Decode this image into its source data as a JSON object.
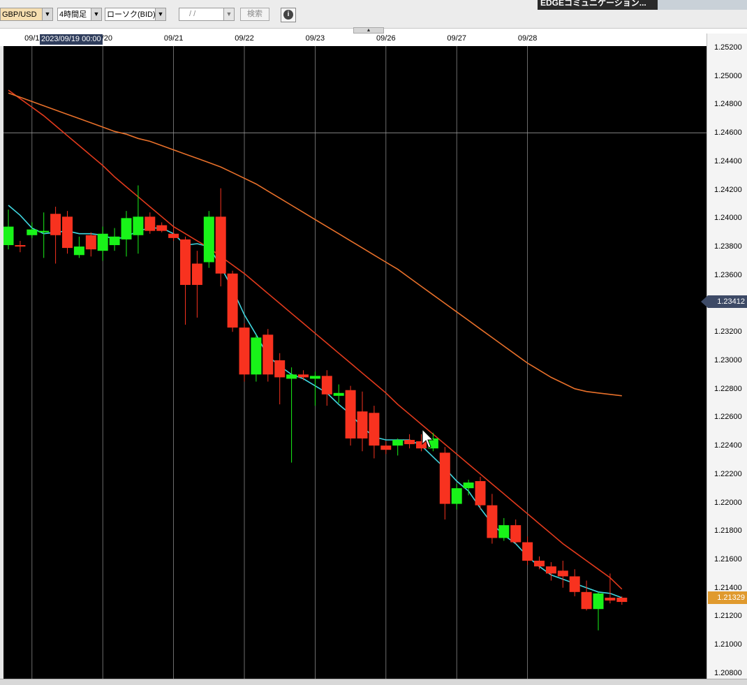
{
  "toolbar": {
    "pair": "GBP/USD",
    "timeframe": "4時間足",
    "chart_type": "ローソク(BID)",
    "date_placeholder": "/ /",
    "search_label": "検索",
    "info_label": "i",
    "webcam_label": "EDGEコミュニケーション..."
  },
  "crosshair": {
    "date_label": "2023/09/19 00:00",
    "price_label": "1.23412",
    "price_value": 1.23412
  },
  "current_price": {
    "label": "1.21329",
    "value": 1.21329
  },
  "colors": {
    "bull": "#19f319",
    "bear": "#f8321f",
    "ma_short": "#40d6e0",
    "ma_mid": "#e23a1c",
    "ma_long": "#e8702a",
    "grid": "#b4b4b4",
    "crosshair_tag": "#3d4a66",
    "current_tag": "#e09a2e"
  },
  "chart_data": {
    "type": "candlestick",
    "symbol": "GBP/USD",
    "timeframe": "4時間足",
    "ylim": [
      1.2076,
      1.2521
    ],
    "y_ticks": [
      "1.25200",
      "1.25000",
      "1.24800",
      "1.24600",
      "1.24400",
      "1.24200",
      "1.24000",
      "1.23800",
      "1.23600",
      "1.23400",
      "1.23200",
      "1.23000",
      "1.22800",
      "1.22600",
      "1.22400",
      "1.22200",
      "1.22000",
      "1.21800",
      "1.21600",
      "1.21400",
      "1.21200",
      "1.21000",
      "1.20800"
    ],
    "x_ticks": [
      {
        "label": "09/1",
        "index": 2
      },
      {
        "label": "09/20",
        "index": 8
      },
      {
        "label": "09/21",
        "index": 14
      },
      {
        "label": "09/22",
        "index": 20
      },
      {
        "label": "09/23",
        "index": 26
      },
      {
        "label": "09/26",
        "index": 32
      },
      {
        "label": "09/27",
        "index": 38
      },
      {
        "label": "09/28",
        "index": 44
      }
    ],
    "candles": [
      {
        "o": 1.2381,
        "h": 1.2406,
        "l": 1.2378,
        "c": 1.2394
      },
      {
        "o": 1.2381,
        "h": 1.2384,
        "l": 1.2376,
        "c": 1.238
      },
      {
        "o": 1.2388,
        "h": 1.2397,
        "l": 1.2386,
        "c": 1.2392
      },
      {
        "o": 1.239,
        "h": 1.2404,
        "l": 1.2372,
        "c": 1.2391
      },
      {
        "o": 1.2403,
        "h": 1.2408,
        "l": 1.2368,
        "c": 1.2388
      },
      {
        "o": 1.2401,
        "h": 1.2405,
        "l": 1.2375,
        "c": 1.2379
      },
      {
        "o": 1.2374,
        "h": 1.2387,
        "l": 1.2372,
        "c": 1.238
      },
      {
        "o": 1.2388,
        "h": 1.239,
        "l": 1.2373,
        "c": 1.2378
      },
      {
        "o": 1.2377,
        "h": 1.2394,
        "l": 1.237,
        "c": 1.2389
      },
      {
        "o": 1.2381,
        "h": 1.2393,
        "l": 1.2377,
        "c": 1.2387
      },
      {
        "o": 1.2385,
        "h": 1.2405,
        "l": 1.2373,
        "c": 1.24
      },
      {
        "o": 1.2388,
        "h": 1.2423,
        "l": 1.2375,
        "c": 1.2401
      },
      {
        "o": 1.2401,
        "h": 1.2404,
        "l": 1.2389,
        "c": 1.2391
      },
      {
        "o": 1.2395,
        "h": 1.2397,
        "l": 1.239,
        "c": 1.2391
      },
      {
        "o": 1.2389,
        "h": 1.2394,
        "l": 1.2384,
        "c": 1.2386
      },
      {
        "o": 1.2385,
        "h": 1.2387,
        "l": 1.2325,
        "c": 1.2353
      },
      {
        "o": 1.2368,
        "h": 1.2377,
        "l": 1.233,
        "c": 1.2353
      },
      {
        "o": 1.2369,
        "h": 1.2405,
        "l": 1.2365,
        "c": 1.2401
      },
      {
        "o": 1.2401,
        "h": 1.2421,
        "l": 1.2352,
        "c": 1.2361
      },
      {
        "o": 1.2361,
        "h": 1.2363,
        "l": 1.232,
        "c": 1.2323
      },
      {
        "o": 1.2323,
        "h": 1.2326,
        "l": 1.2285,
        "c": 1.229
      },
      {
        "o": 1.229,
        "h": 1.2318,
        "l": 1.2285,
        "c": 1.2316
      },
      {
        "o": 1.2318,
        "h": 1.2322,
        "l": 1.2285,
        "c": 1.229
      },
      {
        "o": 1.23,
        "h": 1.2305,
        "l": 1.2269,
        "c": 1.2288
      },
      {
        "o": 1.2287,
        "h": 1.2295,
        "l": 1.2228,
        "c": 1.229
      },
      {
        "o": 1.229,
        "h": 1.2293,
        "l": 1.2286,
        "c": 1.2288
      },
      {
        "o": 1.2287,
        "h": 1.2292,
        "l": 1.2268,
        "c": 1.2289
      },
      {
        "o": 1.2289,
        "h": 1.2293,
        "l": 1.2268,
        "c": 1.2276
      },
      {
        "o": 1.2275,
        "h": 1.2283,
        "l": 1.227,
        "c": 1.2277
      },
      {
        "o": 1.2279,
        "h": 1.2282,
        "l": 1.224,
        "c": 1.2245
      },
      {
        "o": 1.2264,
        "h": 1.2278,
        "l": 1.2236,
        "c": 1.2245
      },
      {
        "o": 1.2263,
        "h": 1.2268,
        "l": 1.2231,
        "c": 1.224
      },
      {
        "o": 1.224,
        "h": 1.2243,
        "l": 1.2234,
        "c": 1.2237
      },
      {
        "o": 1.224,
        "h": 1.2245,
        "l": 1.2233,
        "c": 1.2244
      },
      {
        "o": 1.2244,
        "h": 1.2248,
        "l": 1.2238,
        "c": 1.2241
      },
      {
        "o": 1.2243,
        "h": 1.2248,
        "l": 1.2236,
        "c": 1.2238
      },
      {
        "o": 1.2238,
        "h": 1.2249,
        "l": 1.2236,
        "c": 1.2245
      },
      {
        "o": 1.2235,
        "h": 1.2239,
        "l": 1.2188,
        "c": 1.2199
      },
      {
        "o": 1.2199,
        "h": 1.2213,
        "l": 1.2195,
        "c": 1.221
      },
      {
        "o": 1.221,
        "h": 1.2216,
        "l": 1.2205,
        "c": 1.2214
      },
      {
        "o": 1.2215,
        "h": 1.2218,
        "l": 1.2195,
        "c": 1.2198
      },
      {
        "o": 1.2198,
        "h": 1.2206,
        "l": 1.2171,
        "c": 1.2175
      },
      {
        "o": 1.2175,
        "h": 1.2189,
        "l": 1.2173,
        "c": 1.2184
      },
      {
        "o": 1.2184,
        "h": 1.2188,
        "l": 1.2171,
        "c": 1.2172
      },
      {
        "o": 1.2172,
        "h": 1.2176,
        "l": 1.2156,
        "c": 1.2159
      },
      {
        "o": 1.2159,
        "h": 1.2162,
        "l": 1.2153,
        "c": 1.2155
      },
      {
        "o": 1.2155,
        "h": 1.2158,
        "l": 1.2145,
        "c": 1.215
      },
      {
        "o": 1.2152,
        "h": 1.2159,
        "l": 1.214,
        "c": 1.2148
      },
      {
        "o": 1.2148,
        "h": 1.2153,
        "l": 1.2134,
        "c": 1.2137
      },
      {
        "o": 1.2137,
        "h": 1.2145,
        "l": 1.2124,
        "c": 1.2125
      },
      {
        "o": 1.2125,
        "h": 1.2137,
        "l": 1.211,
        "c": 1.2136
      },
      {
        "o": 1.2133,
        "h": 1.215,
        "l": 1.2129,
        "c": 1.2131
      },
      {
        "o": 1.2133,
        "h": 1.2134,
        "l": 1.2128,
        "c": 1.213
      }
    ],
    "series": [
      {
        "key": "ma_short",
        "values": [
          1.2409,
          1.2402,
          1.2393,
          1.2389,
          1.239,
          1.2391,
          1.2389,
          1.2389,
          1.2388,
          1.2385,
          1.2387,
          1.2391,
          1.2393,
          1.2393,
          1.2389,
          1.2381,
          1.2382,
          1.238,
          1.2366,
          1.235,
          1.2332,
          1.2318,
          1.2303,
          1.2296,
          1.229,
          1.2287,
          1.2282,
          1.2277,
          1.2269,
          1.2262,
          1.2253,
          1.2246,
          1.2244,
          1.2244,
          1.2244,
          1.224,
          1.2232,
          1.2224,
          1.2215,
          1.2208,
          1.2196,
          1.2185,
          1.2177,
          1.2171,
          1.2162,
          1.2155,
          1.2149,
          1.2146,
          1.2143,
          1.214,
          1.2137,
          1.2136,
          1.2133
        ]
      },
      {
        "key": "ma_mid",
        "values": [
          1.249,
          1.2484,
          1.2478,
          1.2472,
          1.2465,
          1.2458,
          1.2451,
          1.2444,
          1.2437,
          1.2429,
          1.2422,
          1.2415,
          1.2408,
          1.2401,
          1.2394,
          1.2389,
          1.2384,
          1.2379,
          1.2373,
          1.2367,
          1.2361,
          1.2354,
          1.2347,
          1.234,
          1.2333,
          1.2326,
          1.2319,
          1.2312,
          1.2305,
          1.2298,
          1.2291,
          1.2284,
          1.2277,
          1.2269,
          1.2262,
          1.2255,
          1.2248,
          1.2241,
          1.2234,
          1.2227,
          1.222,
          1.2213,
          1.2206,
          1.2199,
          1.2192,
          1.2185,
          1.2178,
          1.2171,
          1.2165,
          1.2159,
          1.2153,
          1.2147,
          1.2139
        ]
      },
      {
        "key": "ma_long",
        "values": [
          1.2488,
          1.2485,
          1.2482,
          1.2479,
          1.2476,
          1.2473,
          1.247,
          1.2467,
          1.2464,
          1.2461,
          1.2459,
          1.2456,
          1.2454,
          1.2451,
          1.2448,
          1.2445,
          1.2442,
          1.2439,
          1.2436,
          1.2432,
          1.2428,
          1.2424,
          1.2419,
          1.2414,
          1.2409,
          1.2404,
          1.2399,
          1.2394,
          1.2389,
          1.2384,
          1.2379,
          1.2374,
          1.2369,
          1.2364,
          1.2358,
          1.2352,
          1.2346,
          1.234,
          1.2334,
          1.2328,
          1.2322,
          1.2316,
          1.231,
          1.2304,
          1.2298,
          1.2293,
          1.2288,
          1.2284,
          1.228,
          1.2278,
          1.2277,
          1.2276,
          1.2275
        ]
      }
    ]
  }
}
